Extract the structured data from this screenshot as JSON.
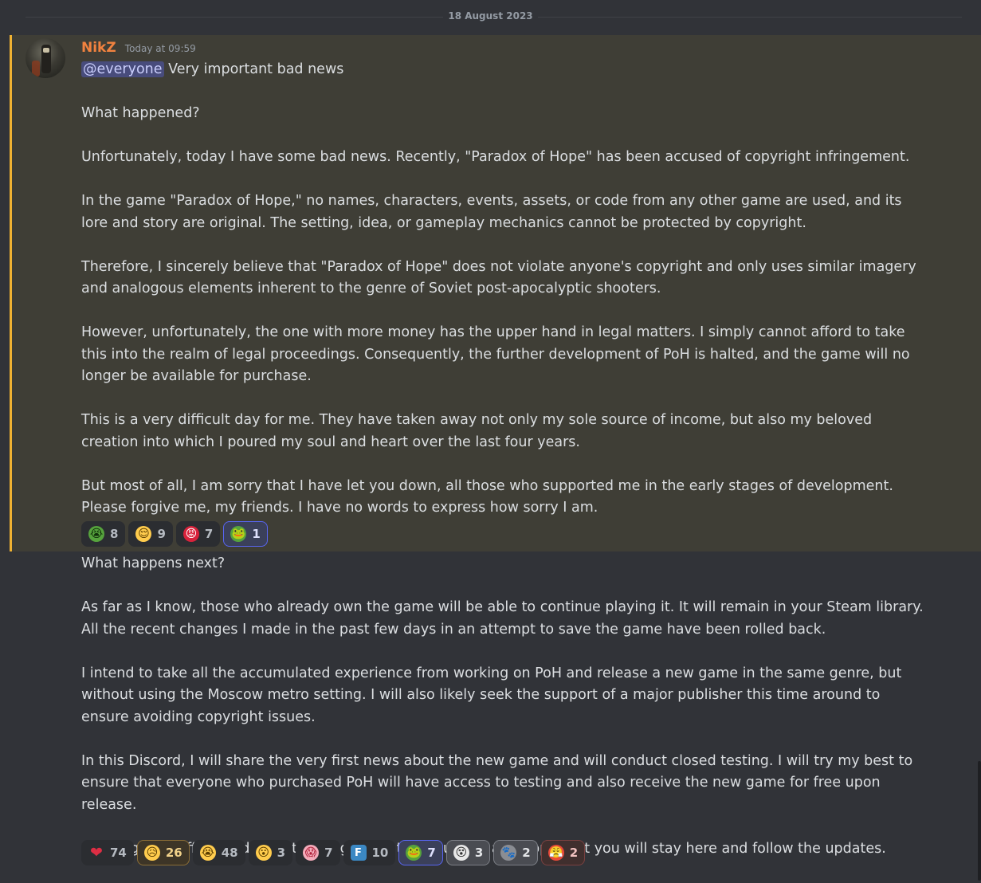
{
  "date_divider": "18 August 2023",
  "message": {
    "author": "NikZ",
    "timestamp": "Today at 09:59",
    "mention": "@everyone",
    "first_line": " Very important bad news",
    "highlighted_paragraphs": [
      "What happened?",
      "Unfortunately, today I have some bad news. Recently, \"Paradox of Hope\" has been accused of copyright infringement.",
      "In the game \"Paradox of Hope,\" no names, characters, events, assets, or code from any other game are used, and its lore and story are original. The setting, idea, or gameplay mechanics cannot be protected by copyright.",
      "Therefore, I sincerely believe that \"Paradox of Hope\" does not violate anyone's copyright and only uses similar imagery and analogous elements inherent to the genre of Soviet post-apocalyptic shooters.",
      "However, unfortunately, the one with more money has the upper hand in legal matters. I simply cannot afford to take this into the realm of legal proceedings. Consequently, the further development of PoH is halted, and the game will no longer be available for purchase.",
      "This is a very difficult day for me. They have taken away not only my sole source of income, but also my beloved creation into which I poured my soul and heart over the last four years.",
      "But most of all, I am sorry that I have let you down, all those who supported me in the early stages of development. Please forgive me, my friends. I have no words to express how sorry I am."
    ],
    "reactions_1": [
      {
        "emoji": "crying-frog-icon",
        "glyph": "😭",
        "count": "8"
      },
      {
        "emoji": "relieved-face-icon",
        "glyph": "😌",
        "count": "9"
      },
      {
        "emoji": "angry-face-icon",
        "glyph": "😡",
        "count": "7"
      },
      {
        "emoji": "frog-lying-icon",
        "glyph": "🐸",
        "count": "1"
      }
    ]
  },
  "followup": {
    "paragraphs": [
      "What happens next?",
      "As far as I know, those who already own the game will be able to continue playing it. It will remain in your Steam library. All the recent changes I made in the past few days in an attempt to save the game have been rolled back.",
      "I intend to take all the accumulated experience from working on PoH and release a new game in the same genre, but without using the Moscow metro setting. I will also likely seek the support of a major publisher this time around to ensure avoiding copyright issues.",
      "In this Discord, I will share the very first news about the new game and will conduct closed testing. I will try my best to ensure that everyone who purchased PoH will have access to testing and also receive the new game for free upon release.",
      "Once again, I offer my deepest apologies for this situation and hope that you will stay here and follow the updates."
    ],
    "reactions_2": [
      {
        "emoji": "red-heart-icon",
        "glyph": "❤",
        "count": "74"
      },
      {
        "emoji": "sad-tear-face-icon",
        "glyph": "😥",
        "count": "26"
      },
      {
        "emoji": "loudly-crying-face-icon",
        "glyph": "😭",
        "count": "48"
      },
      {
        "emoji": "surprised-face-icon",
        "glyph": "😮",
        "count": "3"
      },
      {
        "emoji": "pink-face-icon",
        "glyph": "😱",
        "count": "7"
      },
      {
        "emoji": "letter-f-icon",
        "glyph": "F",
        "count": "10"
      },
      {
        "emoji": "frog-icon",
        "glyph": "🐸",
        "count": "7"
      },
      {
        "emoji": "dizzy-face-icon",
        "glyph": "😵",
        "count": "3"
      },
      {
        "emoji": "animal-face-icon",
        "glyph": "🐾",
        "count": "2"
      },
      {
        "emoji": "red-angry-face-icon",
        "glyph": "😤",
        "count": "2"
      }
    ]
  },
  "colors": {
    "background": "#313338",
    "highlight_background": "#3f3e36",
    "highlight_bar": "#f0b232",
    "username": "#f1823f",
    "mention_bg": "#484c7c"
  }
}
